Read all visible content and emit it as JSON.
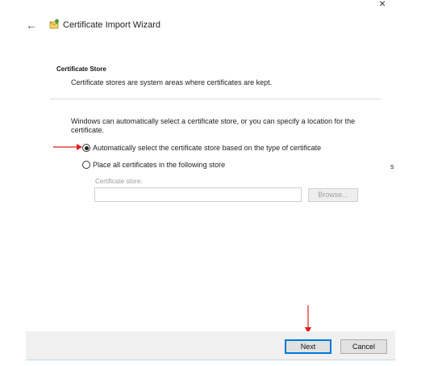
{
  "window": {
    "close_glyph": "×",
    "back_glyph": "←",
    "title": "Certificate Import Wizard",
    "icon": "certificate-wizard-icon"
  },
  "section": {
    "title": "Certificate Store",
    "description": "Certificate stores are system areas where certificates are kept."
  },
  "body": {
    "intro": "Windows can automatically select a certificate store, or you can specify a location for the certificate.",
    "options": [
      {
        "label": "Automatically select the certificate store based on the type of certificate",
        "selected": true
      },
      {
        "label": "Place all certificates in the following store",
        "selected": false
      }
    ],
    "store_label": "Certificate store:",
    "store_value": "",
    "browse_label": "Browse..."
  },
  "side_mark": "s",
  "annotations": {
    "arrow_color": "#e02020"
  },
  "footer": {
    "next_label": "Next",
    "cancel_label": "Cancel"
  },
  "colors": {
    "focus_border": "#0078d7",
    "footer_bg": "#f0f0f0"
  }
}
